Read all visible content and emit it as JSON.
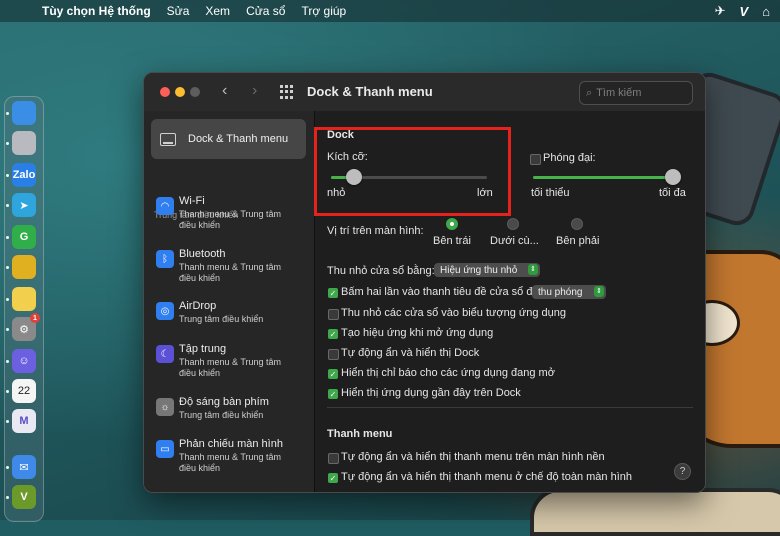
{
  "menubar": {
    "app_name": "Tùy chọn Hệ thống",
    "items": [
      "Sửa",
      "Xem",
      "Cửa sổ",
      "Trợ giúp"
    ]
  },
  "window": {
    "title": "Dock & Thanh menu",
    "search_placeholder": "Tìm kiếm"
  },
  "sidebar": {
    "selected": "Dock & Thanh menu",
    "section_title": "Trung tâm điều khiển",
    "items": [
      {
        "name": "Wi-Fi",
        "sub": "Thanh menu & Trung tâm điều khiển",
        "icon": "wifi-icon",
        "color": "#2f7ff0"
      },
      {
        "name": "Bluetooth",
        "sub": "Thanh menu & Trung tâm điều khiển",
        "icon": "bluetooth-icon",
        "color": "#2f7ff0"
      },
      {
        "name": "AirDrop",
        "sub": "Trung tâm điều khiển",
        "icon": "airdrop-icon",
        "color": "#2f7ff0"
      },
      {
        "name": "Tập trung",
        "sub": "Thanh menu & Trung tâm điều khiển",
        "icon": "moon-icon",
        "color": "#5b50d6"
      },
      {
        "name": "Độ sáng bàn phím",
        "sub": "Trung tâm điều khiển",
        "icon": "keyboard-brightness-icon",
        "color": "#777777"
      },
      {
        "name": "Phản chiếu màn hình",
        "sub": "Thanh menu & Trung tâm điều khiển",
        "icon": "screen-mirroring-icon",
        "color": "#2f7ff0"
      }
    ]
  },
  "dock_section": {
    "title": "Dock",
    "size_label": "Kích cỡ:",
    "size_min": "nhỏ",
    "size_max": "lớn",
    "size_value": 0.15,
    "magnify_label": "Phóng đại:",
    "magnify_checked": false,
    "magnify_min": "tối thiểu",
    "magnify_max": "tối đa",
    "magnify_value": 1.0,
    "position_label": "Vị trí trên màn hình:",
    "positions": [
      "Bên trái",
      "Dưới cù...",
      "Bên phải"
    ],
    "position_selected": 0,
    "minimize_label": "Thu nhỏ cửa sổ bằng:",
    "minimize_value": "Hiệu ứng thu nhỏ",
    "doubleclick_label": "Bấm hai lần vào thanh tiêu đề cửa sổ để",
    "doubleclick_value": "thu phóng",
    "checkboxes": [
      {
        "label": "Bấm hai lần vào thanh tiêu đề cửa sổ để",
        "checked": true
      },
      {
        "label": "Thu nhỏ các cửa sổ vào biểu tượng ứng dụng",
        "checked": false
      },
      {
        "label": "Tạo hiệu ứng khi mở ứng dụng",
        "checked": true
      },
      {
        "label": "Tự động ẩn và hiển thị Dock",
        "checked": false
      },
      {
        "label": "Hiển thị chỉ báo cho các ứng dụng đang mở",
        "checked": true
      },
      {
        "label": "Hiển thị ứng dụng gần đây trên Dock",
        "checked": true
      }
    ]
  },
  "menubar_section": {
    "title": "Thanh menu",
    "checkboxes": [
      {
        "label": "Tự động ẩn và hiển thị thanh menu trên màn hình nền",
        "checked": false
      },
      {
        "label": "Tự động ẩn và hiển thị thanh menu ở chế độ toàn màn hình",
        "checked": true
      }
    ]
  },
  "dock_apps": [
    {
      "name": "finder",
      "label": "",
      "color": "#3a8ee6"
    },
    {
      "name": "launchpad",
      "label": "",
      "color": "#b9b9c0"
    },
    {
      "name": "zalo",
      "label": "Zalo",
      "color": "#2a7fe6"
    },
    {
      "name": "telegram",
      "label": "➤",
      "color": "#2ea6dd"
    },
    {
      "name": "app-green",
      "label": "G",
      "color": "#2fae4a"
    },
    {
      "name": "chrome",
      "label": "",
      "color": "#e0b020"
    },
    {
      "name": "notes",
      "label": "",
      "color": "#f2d04d"
    },
    {
      "name": "system-preferences",
      "label": "⚙",
      "color": "#8a8a8a"
    },
    {
      "name": "discord",
      "label": "☺",
      "color": "#6c5fe0"
    },
    {
      "name": "calendar",
      "label": "22",
      "color": "#f5f5f5"
    },
    {
      "name": "app-m",
      "label": "M",
      "color": "#e9e9f3"
    },
    {
      "name": "mail",
      "label": "✉",
      "color": "#3f8ae8"
    },
    {
      "name": "app-v",
      "label": "V",
      "color": "#6c9a2a"
    }
  ],
  "calendar_label": "22",
  "help_label": "?"
}
